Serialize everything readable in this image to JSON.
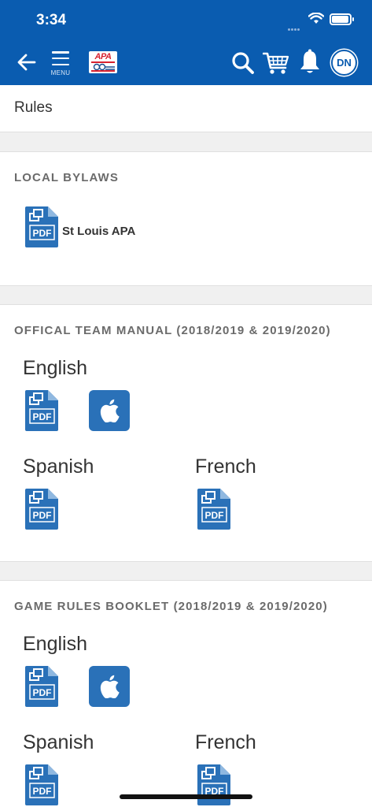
{
  "status_bar": {
    "time": "3:34"
  },
  "header": {
    "menu_label": "MENU",
    "logo_text": "APA",
    "avatar_initials": "DN",
    "icons": [
      "back-arrow-icon",
      "hamburger-menu-icon",
      "search-icon",
      "cart-icon",
      "bell-icon"
    ],
    "background_color": "#0a5cb0"
  },
  "page": {
    "title": "Rules"
  },
  "local_bylaws": {
    "heading": "LOCAL BYLAWS",
    "documents": [
      {
        "label": "St Louis APA",
        "icon": "pdf-icon"
      }
    ]
  },
  "team_manual": {
    "heading": "OFFICAL TEAM MANUAL (2018/2019 & 2019/2020)",
    "languages": [
      {
        "name": "English",
        "formats": [
          "pdf",
          "apple-books"
        ]
      },
      {
        "name": "Spanish",
        "formats": [
          "pdf"
        ]
      },
      {
        "name": "French",
        "formats": [
          "pdf"
        ]
      }
    ]
  },
  "rules_booklet": {
    "heading": "GAME RULES BOOKLET (2018/2019 & 2019/2020)",
    "languages": [
      {
        "name": "English",
        "formats": [
          "pdf",
          "apple-books"
        ]
      },
      {
        "name": "Spanish",
        "formats": [
          "pdf"
        ]
      },
      {
        "name": "French",
        "formats": [
          "pdf"
        ]
      }
    ]
  },
  "colors": {
    "accent": "#2a71b8",
    "section_heading": "#6b6b6b"
  }
}
